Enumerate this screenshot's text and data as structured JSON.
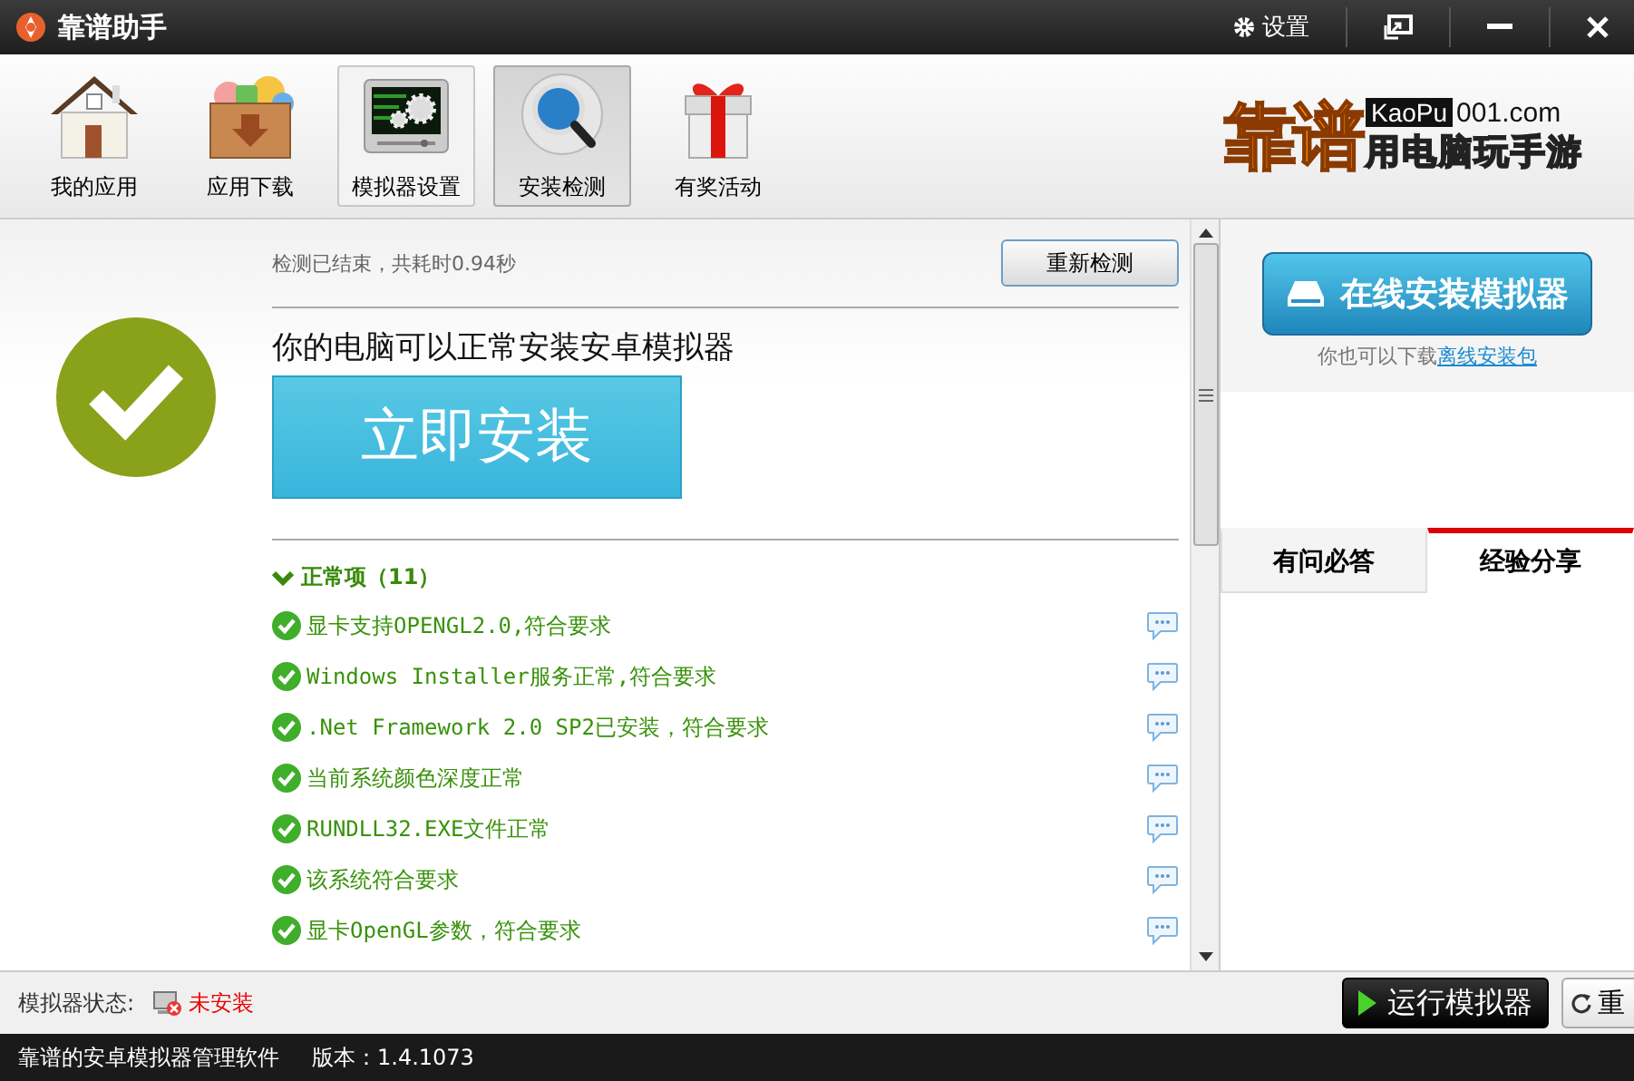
{
  "window": {
    "title": "靠谱助手",
    "settings_label": "设置"
  },
  "toolbar": {
    "items": [
      {
        "kind": "house",
        "label": "我的应用",
        "selected": false,
        "highlighted": false
      },
      {
        "kind": "crate",
        "label": "应用下载",
        "selected": false,
        "highlighted": false
      },
      {
        "kind": "monitor",
        "label": "模拟器设置",
        "selected": false,
        "highlighted": true
      },
      {
        "kind": "magnifier",
        "label": "安装检测",
        "selected": true,
        "highlighted": false
      },
      {
        "kind": "gift",
        "label": "有奖活动",
        "selected": false,
        "highlighted": false
      }
    ]
  },
  "logo": {
    "brand": "靠谱",
    "domain_box": "KaoPu",
    "domain_rest": "001.com",
    "slogan": "用电脑玩手游"
  },
  "check": {
    "status": "检测已结束，共耗时0.94秒",
    "recheck_button": "重新检测",
    "ok": true,
    "headline": "你的电脑可以正常安装安卓模拟器",
    "install_button": "立即安装",
    "group": {
      "label": "正常项（11）",
      "expanded": true,
      "items": [
        {
          "text": "显卡支持OPENGL2.0,符合要求",
          "ok": true
        },
        {
          "text": "Windows Installer服务正常,符合要求",
          "ok": true
        },
        {
          "text": ".Net Framework 2.0 SP2已安装，符合要求",
          "ok": true
        },
        {
          "text": "当前系统颜色深度正常",
          "ok": true
        },
        {
          "text": "RUNDLL32.EXE文件正常",
          "ok": true
        },
        {
          "text": "该系统符合要求",
          "ok": true
        },
        {
          "text": "显卡OpenGL参数，符合要求",
          "ok": true
        }
      ]
    }
  },
  "side": {
    "online_button": "在线安装模拟器",
    "offline_note": "你也可以下载",
    "offline_link": "离线安装包",
    "tabs": [
      {
        "label": "有问必答",
        "selected": false
      },
      {
        "label": "经验分享",
        "selected": true
      }
    ]
  },
  "status_bar": {
    "label": "模拟器状态:",
    "installed": false,
    "state": "未安装",
    "run_button": "运行模拟器",
    "restart_button": "重"
  },
  "footer": {
    "app_name": "靠谱的安卓模拟器管理软件",
    "version": "版本：1.4.1073"
  }
}
